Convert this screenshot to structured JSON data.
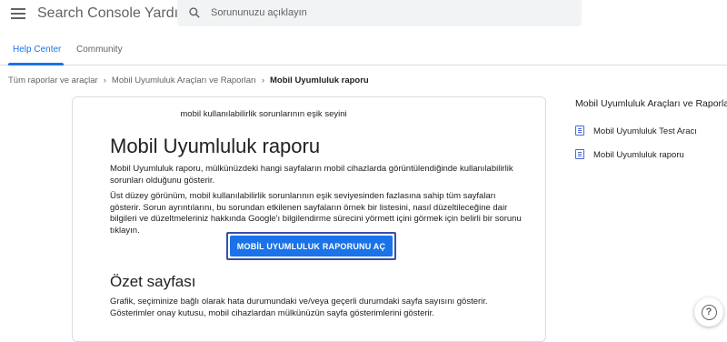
{
  "header": {
    "app_title": "Search Console Yardım",
    "search_placeholder": "Sorununuzu açıklayın"
  },
  "tabs": [
    {
      "label": "Help Center",
      "active": true
    },
    {
      "label": "Community",
      "active": false
    }
  ],
  "breadcrumb": {
    "items": [
      "Tüm raporlar ve araçlar",
      "Mobil Uyumluluk Araçları ve Raporları"
    ],
    "current": "Mobil Uyumluluk raporu"
  },
  "article": {
    "image_caption": "mobil kullanılabilirlik sorunlarının eşik seyini",
    "title": "Mobil Uyumluluk raporu",
    "para1": "Mobil Uyumluluk raporu, mülkünüzdeki hangi sayfaların mobil cihazlarda görüntülendiğinde kullanılabilirlik sorunları olduğunu gösterir.",
    "para2": "Üst düzey görünüm, mobil kullanılabilirlik sorunlarının eşik seviyesinden fazlasına sahip tüm sayfaları gösterir. Sorun ayrıntılarını, bu sorundan etkilenen sayfaların örnek bir listesini, nasıl düzeltileceğine dair bilgileri ve düzeltmeleriniz hakkında Google'ı bilgilendirme sürecini yörmett içini görmek için belirli bir sorunu tıklayın.",
    "open_report_button": "MOBİL UYUMLULUK RAPORUNU AÇ",
    "section_title": "Özet sayfası",
    "para3": "Grafik, seçiminize bağlı olarak hata durumundaki ve/veya geçerli durumdaki sayfa sayısını gösterir. Gösterimler onay kutusu, mobil cihazlardan mülkünüzün sayfa gösterimlerini gösterir."
  },
  "aside": {
    "title": "Mobil Uyumluluk Araçları ve Raporları",
    "items": [
      "Mobil Uyumluluk Test Aracı",
      "Mobil Uyumluluk raporu"
    ]
  },
  "help_button": "?",
  "colors": {
    "accent": "#1a73e8",
    "button_focus": "#3c4bb0",
    "doc_icon": "#4a66d8"
  },
  "icons": {
    "menu": "menu-icon",
    "search": "search-icon",
    "doc": "document-icon",
    "help": "help-icon"
  }
}
